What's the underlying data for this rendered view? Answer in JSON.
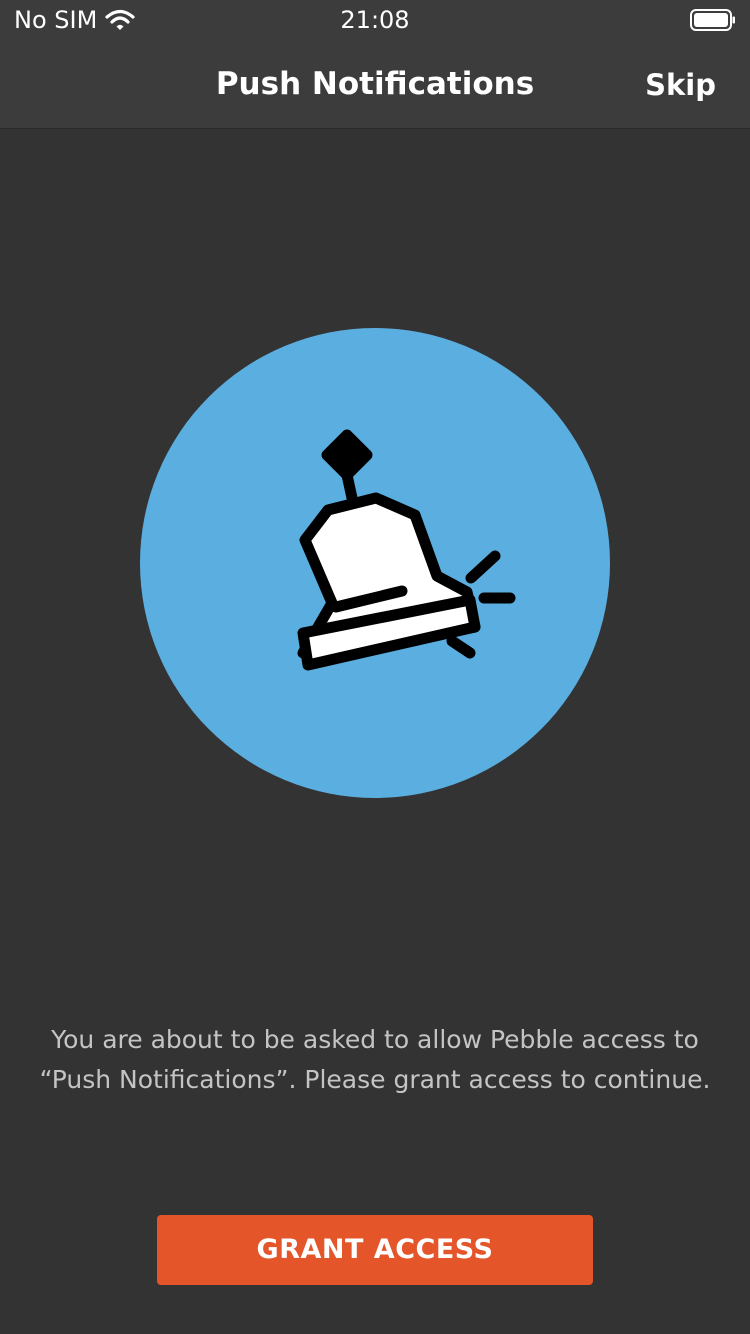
{
  "status_bar": {
    "carrier": "No SIM",
    "time": "21:08",
    "wifi_icon": "wifi-icon",
    "battery_icon": "battery-icon"
  },
  "nav": {
    "title": "Push Notifications",
    "skip_label": "Skip"
  },
  "hero": {
    "icon": "bell-icon",
    "circle_color": "#5baee0"
  },
  "message": "You are about to be asked to allow Pebble access to “Push Notifications”. Please grant access to continue.",
  "grant_button": {
    "label": "GRANT ACCESS",
    "color": "#e5552a"
  },
  "colors": {
    "background": "#333333",
    "header": "#3c3c3c",
    "text_muted": "#c4c4c4"
  }
}
